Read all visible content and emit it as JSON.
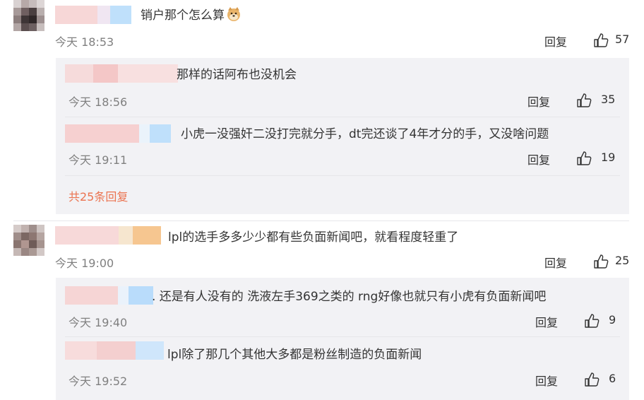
{
  "comments": [
    {
      "text": "销户那个怎么算",
      "emoji": "doge-emoji",
      "time": "今天 18:53",
      "reply_label": "回复",
      "likes": "57",
      "replies": [
        {
          "text": "那样的话阿布也没机会",
          "time": "今天 18:56",
          "reply_label": "回复",
          "likes": "35"
        },
        {
          "text": "小虎一没强奸二没打完就分手，dt完还谈了4年才分的手，又没啥问题",
          "time": "今天 19:11",
          "reply_label": "回复",
          "likes": "19"
        }
      ],
      "more_replies": "共25条回复"
    },
    {
      "text": "lpl的选手多多少少都有些负面新闻吧，就看程度轻重了",
      "time": "今天 19:00",
      "reply_label": "回复",
      "likes": "25",
      "replies": [
        {
          "text": ". 还是有人没有的 洗液左手369之类的 rng好像也就只有小虎有负面新闻吧",
          "time": "今天 19:40",
          "reply_label": "回复",
          "likes": "9"
        },
        {
          "text": "lpl除了那几个其他大多都是粉丝制造的负面新闻",
          "time": "今天 19:52",
          "reply_label": "回复",
          "likes": "6"
        }
      ]
    }
  ],
  "colors": {
    "more_link": "#eb7350",
    "reply_bg": "#f2f2f5",
    "time": "#808080"
  },
  "icons": {
    "like": "thumbs-up-icon"
  }
}
